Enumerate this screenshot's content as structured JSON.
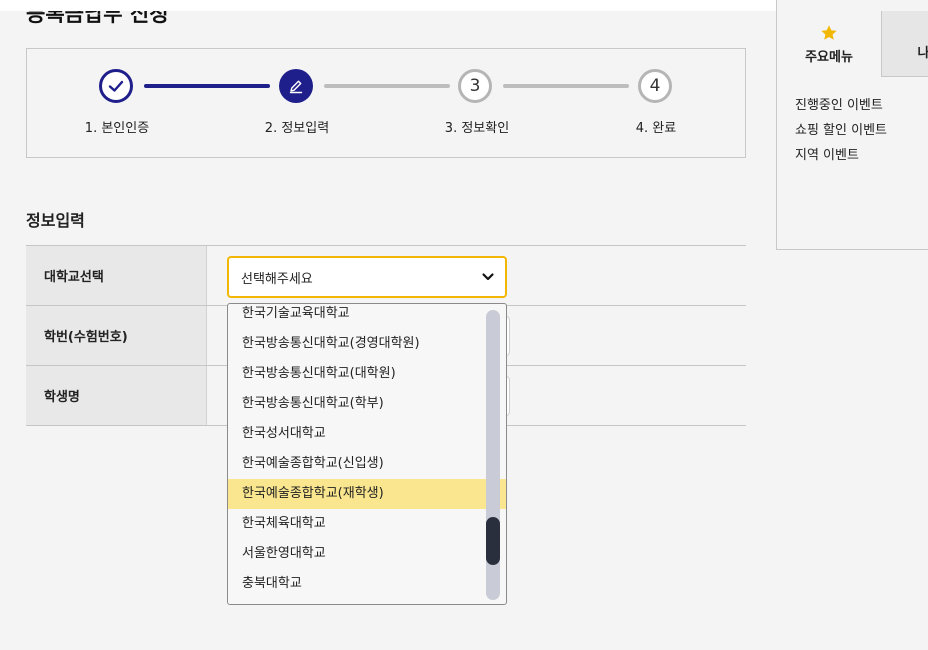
{
  "page": {
    "title": "등록금납부 신청"
  },
  "stepper": {
    "steps": [
      {
        "label": "1. 본인인증",
        "num": ""
      },
      {
        "label": "2. 정보입력",
        "num": ""
      },
      {
        "label": "3. 정보확인",
        "num": "3"
      },
      {
        "label": "4. 완료",
        "num": "4"
      }
    ]
  },
  "form": {
    "section_title": "정보입력",
    "rows": [
      {
        "label": "대학교선택"
      },
      {
        "label": "학번(수험번호)"
      },
      {
        "label": "학생명"
      }
    ],
    "select": {
      "value": "선택해주세요"
    }
  },
  "dropdown": {
    "items": [
      "한국기술교육대학교",
      "한국방송통신대학교(경영대학원)",
      "한국방송통신대학교(대학원)",
      "한국방송통신대학교(학부)",
      "한국성서대학교",
      "한국예술종합학교(신입생)",
      "한국예술종합학교(재학생)",
      "한국체육대학교",
      "서울한영대학교",
      "충북대학교"
    ],
    "highlighted_index": 6
  },
  "side_panel": {
    "tabs": [
      {
        "label": "주요메뉴",
        "icon": "star-icon"
      },
      {
        "label": "나의"
      }
    ],
    "links": [
      "진행중인 이벤트",
      "쇼핑 할인 이벤트",
      "지역 이벤트"
    ]
  },
  "colors": {
    "primary": "#1f1f8c",
    "accent": "#f2b705",
    "highlight": "#fae68e"
  }
}
